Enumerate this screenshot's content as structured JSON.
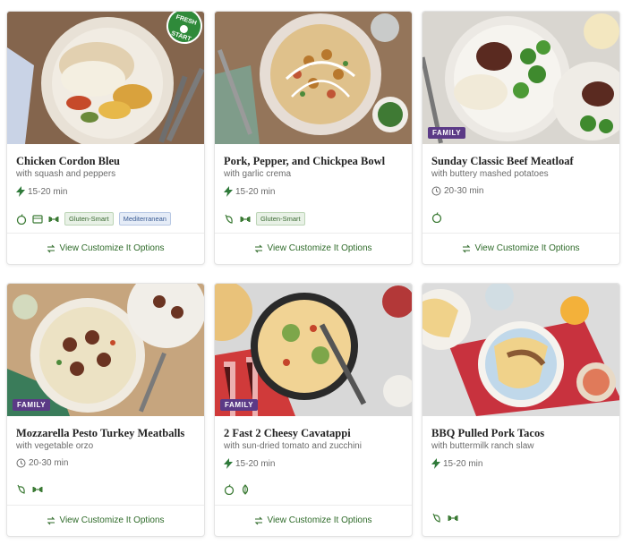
{
  "colors": {
    "accent_green": "#2f6b2a",
    "family_badge": "#5b3a86",
    "fresh_start_badge": "#2f8a3a",
    "chip_gluten_smart": "#e8f1e6",
    "chip_mediterranean": "#e5ecf7"
  },
  "cards": [
    {
      "title": "Chicken Cordon Bleu",
      "subtitle": "with squash and peppers",
      "time": "15-20 min",
      "time_icon": "lightning-icon",
      "badge": "",
      "fresh_badge_line1": "FRESH",
      "fresh_badge_line2": "START",
      "tag_icons": [
        "apple-icon",
        "cooktop-icon",
        "dumbbell-icon"
      ],
      "tag_chips": [
        "Gluten-Smart",
        "Mediterranean"
      ],
      "customize_label": "View Customize It Options"
    },
    {
      "title": "Pork, Pepper, and Chickpea Bowl",
      "subtitle": "with garlic crema",
      "time": "15-20 min",
      "time_icon": "lightning-icon",
      "badge": "",
      "tag_icons": [
        "chili-icon",
        "dumbbell-icon"
      ],
      "tag_chips": [
        "Gluten-Smart"
      ],
      "customize_label": "View Customize It Options"
    },
    {
      "title": "Sunday Classic Beef Meatloaf",
      "subtitle": "with buttery mashed potatoes",
      "time": "20-30 min",
      "time_icon": "clock-icon",
      "badge": "FAMILY",
      "tag_icons": [
        "apple-icon"
      ],
      "tag_chips": [],
      "customize_label": "View Customize It Options"
    },
    {
      "title": "Mozzarella Pesto Turkey Meatballs",
      "subtitle": "with vegetable orzo",
      "time": "20-30 min",
      "time_icon": "clock-icon",
      "badge": "FAMILY",
      "tag_icons": [
        "chili-icon",
        "dumbbell-icon"
      ],
      "tag_chips": [],
      "customize_label": "View Customize It Options"
    },
    {
      "title": "2 Fast 2 Cheesy Cavatappi",
      "subtitle": "with sun-dried tomato and zucchini",
      "time": "15-20 min",
      "time_icon": "lightning-icon",
      "badge": "FAMILY",
      "tag_icons": [
        "apple-icon",
        "leaf-icon"
      ],
      "tag_chips": [],
      "customize_label": "View Customize It Options"
    },
    {
      "title": "BBQ Pulled Pork Tacos",
      "subtitle": "with buttermilk ranch slaw",
      "time": "15-20 min",
      "time_icon": "lightning-icon",
      "badge": "",
      "tag_icons": [
        "chili-icon",
        "dumbbell-icon"
      ],
      "tag_chips": [],
      "customize_label": ""
    }
  ]
}
